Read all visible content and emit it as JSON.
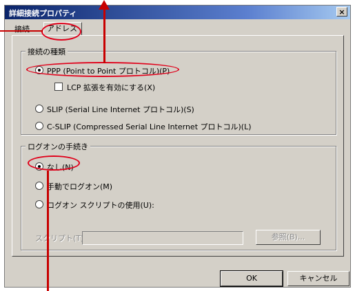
{
  "window": {
    "title": "詳細接続プロパティ",
    "close_label": "×"
  },
  "tabs": [
    {
      "label": "接続",
      "selected": false
    },
    {
      "label": "アドレス",
      "selected": true
    }
  ],
  "connection_type": {
    "legend": "接続の種類",
    "options": [
      {
        "label": "PPP (Point to Point プロトコル)(P)",
        "selected": true
      },
      {
        "label": "SLIP (Serial Line Internet プロトコル)(S)",
        "selected": false
      },
      {
        "label": "C-SLIP (Compressed Serial Line Internet プロトコル)(L)",
        "selected": false
      }
    ],
    "lcp_checkbox": {
      "label": "LCP 拡張を有効にする(X)",
      "checked": false
    }
  },
  "logon": {
    "legend": "ログオンの手続き",
    "options": [
      {
        "label": "なし(N)",
        "selected": true
      },
      {
        "label": "手動でログオン(M)",
        "selected": false
      },
      {
        "label": "ログオン スクリプトの使用(U):",
        "selected": false
      }
    ],
    "script_label": "スクリプト(T):",
    "script_value": "",
    "browse_label": "参照(B)..."
  },
  "buttons": {
    "ok": "OK",
    "cancel": "キャンセル"
  },
  "colors": {
    "annotation": "#e0001a",
    "titlebar": "#0a246a"
  }
}
